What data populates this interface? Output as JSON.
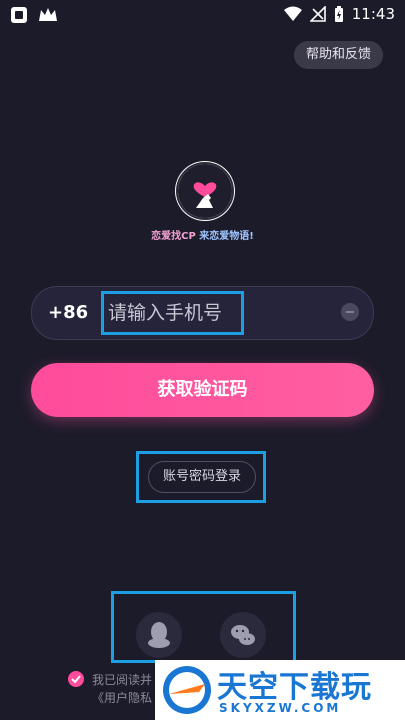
{
  "status": {
    "time": "11:43"
  },
  "help": {
    "label": "帮助和反馈"
  },
  "slogan": {
    "part1": "恋爱找CP",
    "part2": "来恋爱物语!"
  },
  "phone": {
    "country_code": "+86",
    "placeholder": "请输入手机号"
  },
  "get_code": {
    "label": "获取验证码"
  },
  "password_login": {
    "label": "账号密码登录"
  },
  "social": {
    "qq": "qq-login",
    "wechat": "wechat-login"
  },
  "agreement": {
    "line1": "我已阅读并",
    "line2": "《用户隐私"
  },
  "watermark": {
    "title": "天空下载玩",
    "url": "SKYXZW.COM"
  },
  "colors": {
    "accent": "#ff4b9b",
    "highlight": "#1e9fe3",
    "background": "#1c1b2a"
  }
}
